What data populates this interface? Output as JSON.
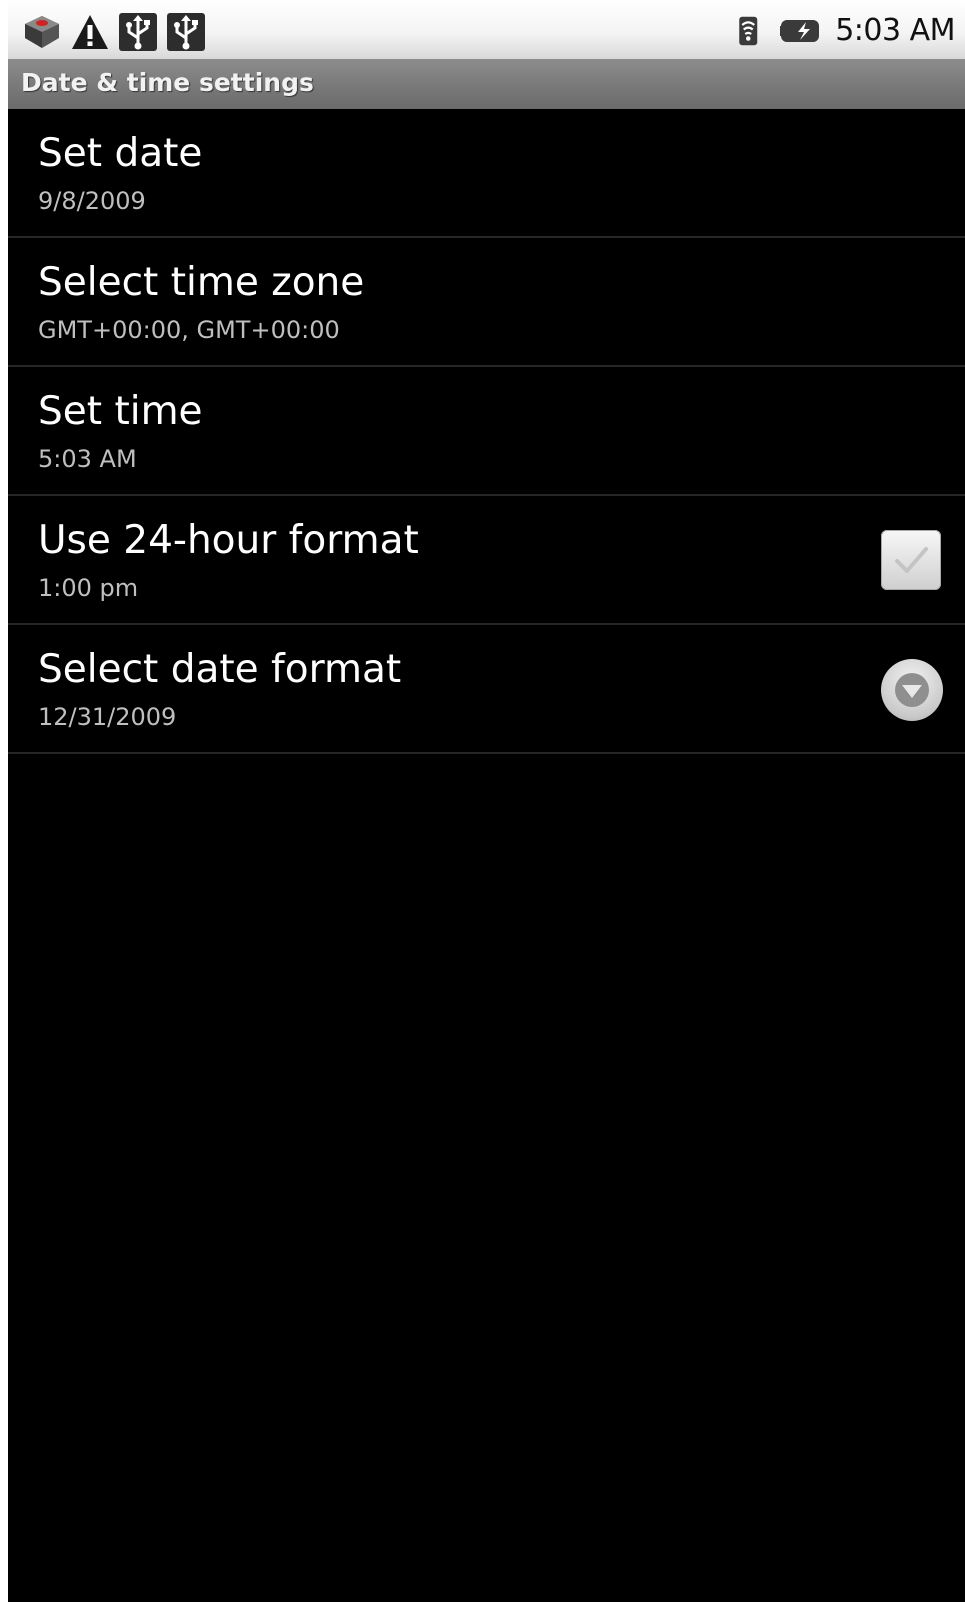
{
  "status_bar": {
    "notification_icons": [
      "android-market-icon",
      "warning-icon",
      "usb-icon",
      "usb-debugging-icon"
    ],
    "system_icons": [
      "wifi-icon",
      "battery-charging-icon"
    ],
    "time": "5:03 AM"
  },
  "title_bar": {
    "title": "Date & time settings"
  },
  "settings": [
    {
      "title": "Set date",
      "summary": "9/8/2009",
      "widget": "none"
    },
    {
      "title": "Select time zone",
      "summary": "GMT+00:00, GMT+00:00",
      "widget": "none"
    },
    {
      "title": "Set time",
      "summary": "5:03 AM",
      "widget": "none"
    },
    {
      "title": "Use 24-hour format",
      "summary": "1:00 pm",
      "widget": "checkbox",
      "checked": false
    },
    {
      "title": "Select date format",
      "summary": "12/31/2009",
      "widget": "dropdown-icon"
    }
  ],
  "colors": {
    "background": "#000000",
    "title_bar": "#7b7b7b",
    "title_text": "#f2f2f2",
    "row_divider": "#262626",
    "summary_text": "#bfbfbf"
  }
}
